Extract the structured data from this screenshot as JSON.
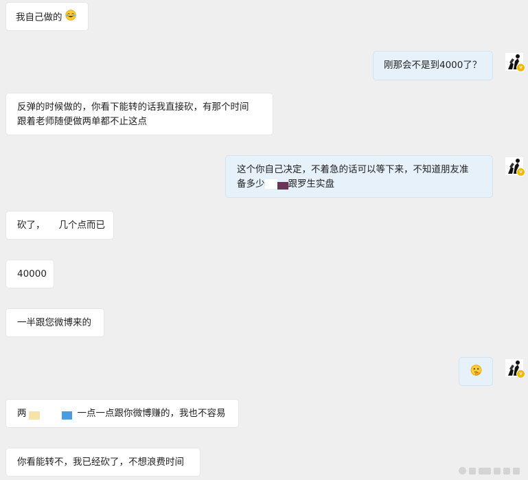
{
  "chat": {
    "messages": [
      {
        "side": "left",
        "text": "我自己做的"
      },
      {
        "side": "right",
        "text": "刚那会不是到4000了？"
      },
      {
        "side": "left",
        "line1": "反弹的时候做的，你看下能转的话我直接砍，有那个时间",
        "line2": "跟着老师随便做两单都不止这点"
      },
      {
        "side": "right",
        "line1": "这个你自己决定，不着急的话可以等下来，不知道朋友准",
        "line2_a": "备多少",
        "line2_b": "跟罗生实盘"
      },
      {
        "side": "left",
        "text_a": "砍了，",
        "text_b": "几个点而已"
      },
      {
        "side": "left",
        "text": "40000"
      },
      {
        "side": "left",
        "text": "一半跟您微博来的"
      },
      {
        "side": "right",
        "text": ""
      },
      {
        "side": "left",
        "text_a": "两",
        "text_b": "一点一点跟你微博赚的，我也不容易"
      },
      {
        "side": "left",
        "text": "你看能转不，我已经砍了，不想浪费时间"
      }
    ]
  },
  "icons": {
    "avatar": "user-avatar-icon",
    "vip_badge": "vip-badge-icon",
    "laugh_emoji": "laughing-tear-emoji-icon",
    "thinking_emoji": "thinking-emoji-icon",
    "watermark": "weibo-watermark-icon"
  },
  "colors": {
    "background": "#efefef",
    "bubble_left": "#ffffff",
    "bubble_right": "#e6f1fa",
    "vip_badge": "#f5b800",
    "mask_purple": "#6b3558",
    "mask_yellow": "#f7e3a8",
    "mask_blue": "#4a9be0"
  }
}
